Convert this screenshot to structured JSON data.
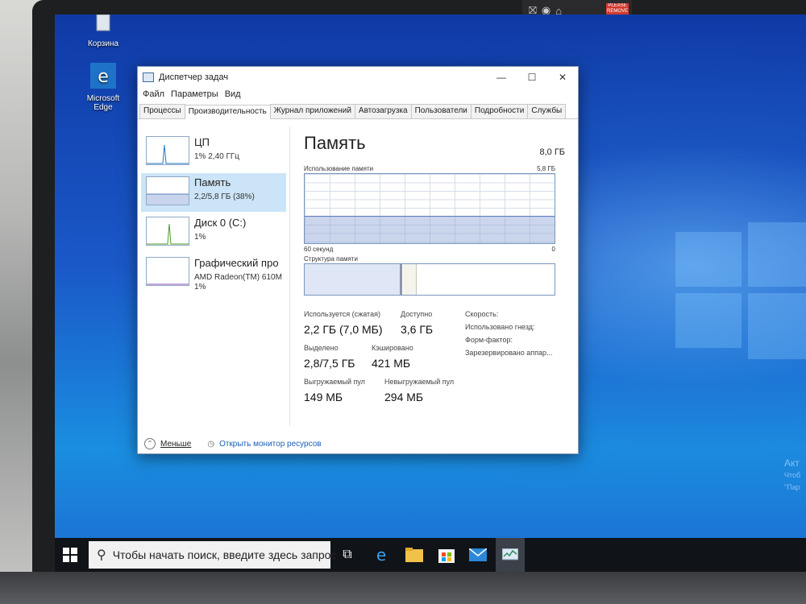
{
  "webcam": {
    "sticker": "PLEASE REMOVE"
  },
  "desktop": {
    "icons": [
      {
        "label": "Корзина"
      },
      {
        "label": "Microsoft Edge"
      }
    ],
    "watermark": [
      "Акт",
      "Чтоб",
      "\"Пар"
    ]
  },
  "taskbar": {
    "search_placeholder": "Чтобы начать поиск, введите здесь запрос",
    "apps": [
      "task-view",
      "edge",
      "explorer",
      "store",
      "mail",
      "task-manager"
    ]
  },
  "taskmanager": {
    "title": "Диспетчер задач",
    "menu": [
      "Файл",
      "Параметры",
      "Вид"
    ],
    "tabs": [
      "Процессы",
      "Производительность",
      "Журнал приложений",
      "Автозагрузка",
      "Пользователи",
      "Подробности",
      "Службы"
    ],
    "active_tab": "Производительность",
    "resources": [
      {
        "name": "ЦП",
        "sub": "1% 2,40 ГГц"
      },
      {
        "name": "Память",
        "sub": "2,2/5,8 ГБ (38%)"
      },
      {
        "name": "Диск 0 (C:)",
        "sub": "1%"
      },
      {
        "name": "Графический про",
        "sub": "AMD Radeon(TM) 610M",
        "sub2": "1%"
      }
    ],
    "memory": {
      "title": "Память",
      "total": "8,0 ГБ",
      "usage_label": "Использование памяти",
      "usage_max": "5,8 ГБ",
      "time_label": "60 секунд",
      "zero_label": "0",
      "usage_fraction": 0.38,
      "structure_label": "Структура памяти",
      "in_use_label": "Используется (сжатая)",
      "in_use_value": "2,2 ГБ (7,0 МБ)",
      "available_label": "Доступно",
      "available_value": "3,6 ГБ",
      "committed_label": "Выделено",
      "committed_value": "2,8/7,5 ГБ",
      "cached_label": "Кэшировано",
      "cached_value": "421 МБ",
      "paged_label": "Выгружаемый пул",
      "paged_value": "149 МБ",
      "nonpaged_label": "Невыгружаемый пул",
      "nonpaged_value": "294 МБ",
      "speed_label": "Скорость:",
      "slots_label": "Использовано гнезд:",
      "form_label": "Форм-фактор:",
      "reserved_label": "Зарезервировано аппар..."
    },
    "footer": {
      "less": "Меньше",
      "monitor": "Открыть монитор ресурсов"
    },
    "colors": {
      "accent": "#cce4f7",
      "graph_line": "#5c7fbf"
    }
  }
}
